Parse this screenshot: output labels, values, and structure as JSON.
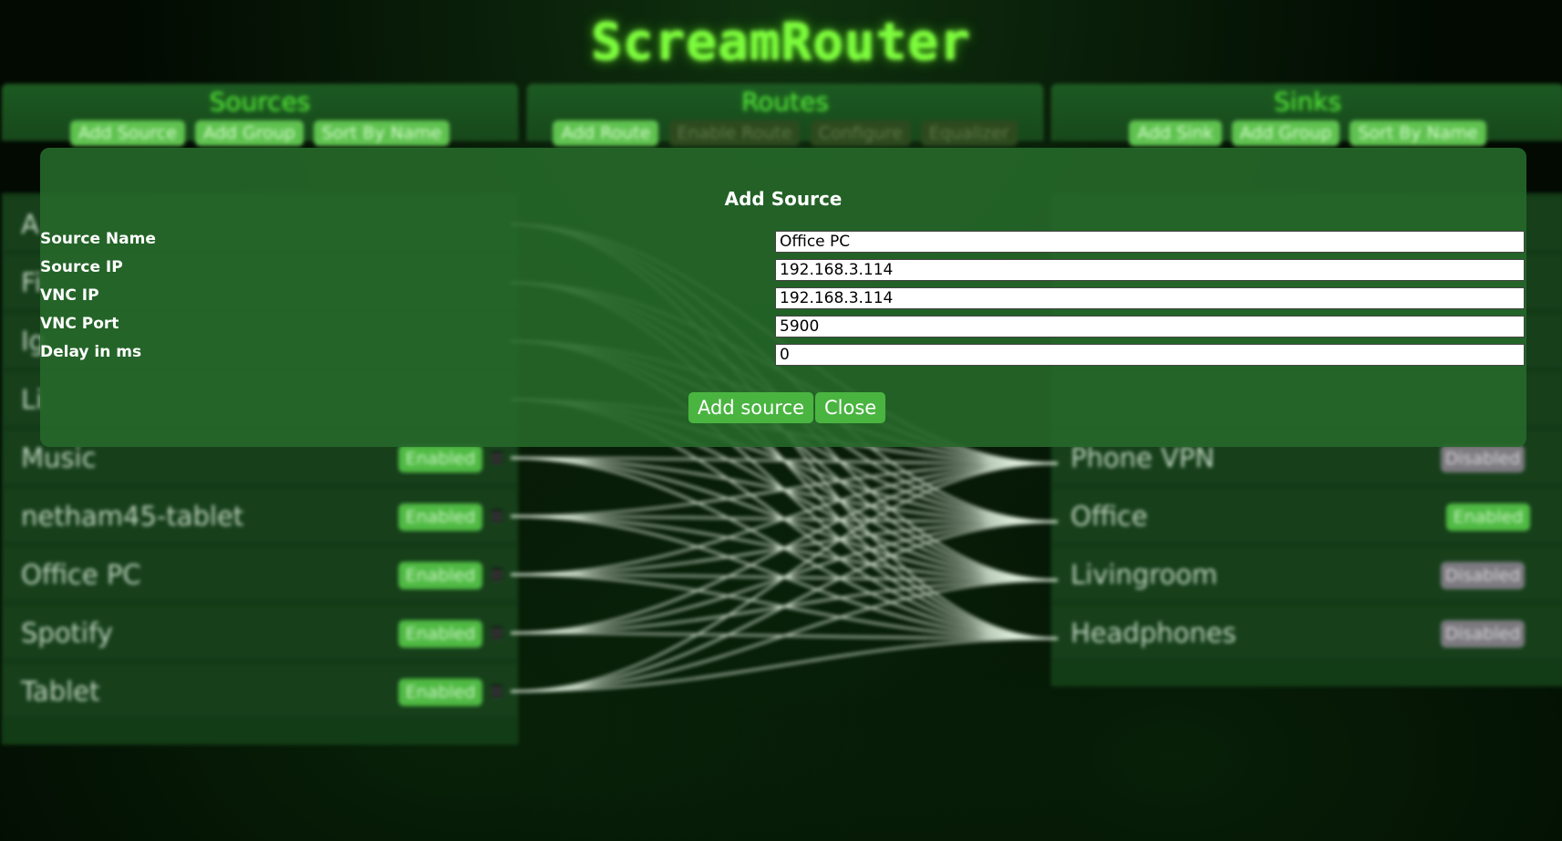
{
  "app_title": "ScreamRouter",
  "sources_panel": {
    "title": "Sources",
    "buttons": [
      "Add Source",
      "Add Group",
      "Sort By Name"
    ],
    "items": [
      {
        "label": "Music",
        "status": "Enabled"
      },
      {
        "label": "netham45-tablet",
        "status": "Enabled"
      },
      {
        "label": "Office PC",
        "status": "Enabled"
      },
      {
        "label": "Spotify",
        "status": "Enabled"
      },
      {
        "label": "Tablet",
        "status": "Enabled"
      }
    ],
    "hidden_initials": [
      "A",
      "Fi",
      "Ig",
      "Li"
    ]
  },
  "routes_panel": {
    "title": "Routes",
    "buttons": [
      "Add Route",
      "Enable Route",
      "Configure",
      "Equalizer"
    ]
  },
  "sinks_panel": {
    "title": "Sinks",
    "buttons": [
      "Add Sink",
      "Add Group",
      "Sort By Name"
    ],
    "items": [
      {
        "label": "Phone VPN",
        "status": "Disabled"
      },
      {
        "label": "Office",
        "status": "Enabled"
      },
      {
        "label": "Livingroom",
        "status": "Disabled"
      },
      {
        "label": "Headphones",
        "status": "Disabled"
      }
    ]
  },
  "modal": {
    "title": "Add Source",
    "fields": [
      {
        "label": "Source Name",
        "value": "Office PC"
      },
      {
        "label": "Source IP",
        "value": "192.168.3.114"
      },
      {
        "label": "VNC IP",
        "value": "192.168.3.114"
      },
      {
        "label": "VNC Port",
        "value": "5900"
      },
      {
        "label": "Delay in ms",
        "value": "0"
      }
    ],
    "add_button": "Add source",
    "close_button": "Close"
  },
  "colors": {
    "accent": "#7dfc3c",
    "panel": "#1c5a22",
    "enabled": "#4fba43",
    "disabled": "#7c7a80",
    "modal": "#26682a"
  }
}
